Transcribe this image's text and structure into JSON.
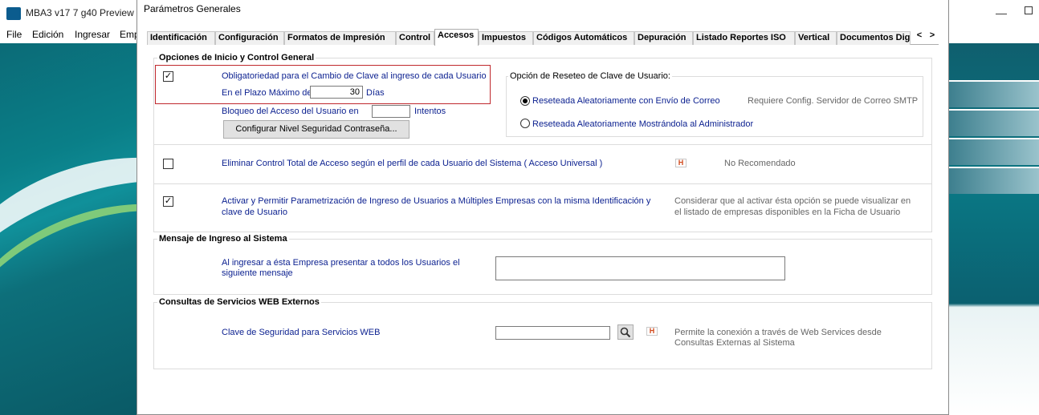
{
  "app": {
    "title": "MBA3  v17 7 g40 Preview",
    "menu": [
      "File",
      "Edición",
      "Ingresar",
      "Emp"
    ]
  },
  "dialog": {
    "title": "Parámetros Generales",
    "tabs": [
      "Identificación",
      "Configuración",
      "Formatos de Impresión",
      "Control",
      "Accesos",
      "Impuestos",
      "Códigos Automáticos",
      "Depuración",
      "Listado Reportes ISO",
      "Vertical",
      "Documentos Dig"
    ],
    "active_tab": "Accesos"
  },
  "inicio": {
    "title": "Opciones de Inicio y Control General",
    "cambio_clave": {
      "label": "Obligatoriedad para el  Cambio de Clave al ingreso de cada Usuario",
      "checked": true,
      "plazo_label": "En el Plazo Máximo de",
      "plazo_value": "30",
      "plazo_unit": "Días"
    },
    "bloqueo": {
      "label": "Bloqueo del Acceso del Usuario en",
      "value": "",
      "unit": "Intentos"
    },
    "config_button": "Configurar Nivel Seguridad Contraseña...",
    "reseteo": {
      "title": "Opción de Reseteo de Clave de Usuario:",
      "option1": "Reseteada Aleatoriamente con Envío de Correo",
      "option1_note": "Requiere Config. Servidor de Correo SMTP",
      "option2": "Reseteada Aleatoriamente Mostrándola al Administrador",
      "selected": 1
    },
    "eliminar": {
      "label": "Eliminar Control Total de Acceso según el perfil de cada Usuario del Sistema ( Acceso Universal )",
      "checked": false,
      "note": "No Recomendado",
      "icon": "help-icon"
    },
    "multiples": {
      "label_line1": "Activar y Permitir Parametrización de Ingreso de Usuarios a Múltiples Empresas con la misma Identificación y",
      "label_line2": "clave de Usuario",
      "checked": true,
      "note_line1": "Considerar que al activar ésta opción se puede visualizar en",
      "note_line2": "el listado de empresas disponibles en la Ficha de Usuario"
    }
  },
  "mensaje": {
    "title": "Mensaje de Ingreso al Sistema",
    "label_line1": "Al ingresar a ésta Empresa presentar a todos los Usuarios el",
    "label_line2": "siguiente mensaje",
    "value": ""
  },
  "web": {
    "title": "Consultas de Servicios WEB Externos",
    "label": "Clave de Seguridad para Servicios WEB",
    "value": "",
    "note_line1": "Permite la conexión a través de Web Services desde",
    "note_line2": "Consultas Externas al Sistema"
  },
  "colors": {
    "label_blue": "#0a1f8f",
    "highlight_red": "#c0282d",
    "brand_teal": "#0a7f88"
  }
}
